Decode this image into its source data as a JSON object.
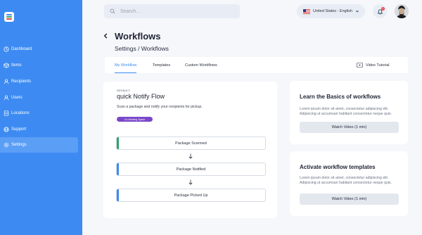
{
  "sidebar": {
    "items": [
      {
        "label": "Dashboard",
        "icon": "clock-icon"
      },
      {
        "label": "Items",
        "icon": "box-icon"
      },
      {
        "label": "Recipients",
        "icon": "user-icon"
      },
      {
        "label": "Users",
        "icon": "users-icon"
      },
      {
        "label": "Locations",
        "icon": "document-icon"
      },
      {
        "label": "Support",
        "icon": "globe-icon"
      },
      {
        "label": "Settings",
        "icon": "gear-icon"
      }
    ],
    "active": "Settings"
  },
  "topbar": {
    "search_placeholder": "Search...",
    "language": "United States - English",
    "notification_count": "1"
  },
  "header": {
    "title": "Workflows",
    "breadcrumb": "Settings / Workflows"
  },
  "tabs": {
    "items": [
      "My Workflow",
      "Templates",
      "Custom Workflows"
    ],
    "active": "My Workflow",
    "video_tutorial": "Video Tutorial"
  },
  "workflow": {
    "default_label": "DEFAULT",
    "title": "quick Notify Flow",
    "description": "Scan a package and notify your recipients for pickup.",
    "badge": "Co-Working Space",
    "steps": [
      {
        "label": "Package Scanned",
        "color": "#2fa36b"
      },
      {
        "label": "Package Notified",
        "color": "#3d8bf2"
      },
      {
        "label": "Package Picked Up",
        "color": "#3d8bf2"
      }
    ]
  },
  "cards": [
    {
      "title": "Learn the Basics of workflows",
      "text": "Lorem ipsum dolor sit amet, consectetur adipiscing elit. Adipiscing ut accumsan habitant consectetur neque quis.",
      "button": "Watch Video (1 min)"
    },
    {
      "title": "Activate workflow templates",
      "text": "Lorem ipsum dolor sit amet, consectetur adipiscing elit. Adipiscing ut accumsan habitant consectetur neque quis.",
      "button": "Watch Video (1 min)"
    }
  ],
  "colors": {
    "sidebar": "#3d8bf2",
    "accent": "#3d8bf2",
    "badge": "#7a48c9"
  }
}
